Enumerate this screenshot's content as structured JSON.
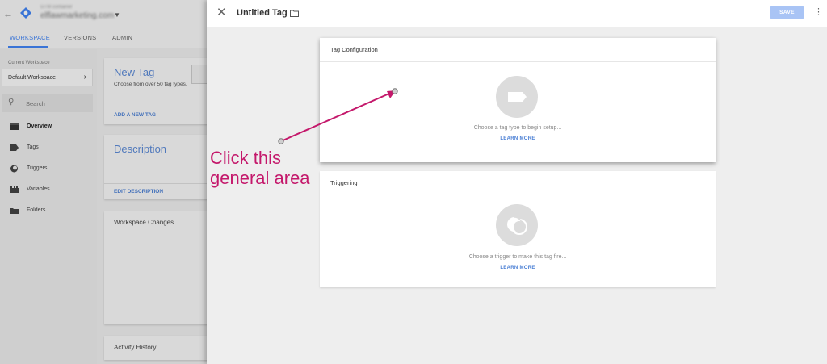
{
  "header": {
    "account_small": "GTM container",
    "account_domain": "elflawmarketing.com"
  },
  "nav_tabs": [
    "WORKSPACE",
    "VERSIONS",
    "ADMIN"
  ],
  "sidebar": {
    "current_workspace_label": "Current Workspace",
    "current_workspace_value": "Default Workspace",
    "search_placeholder": "Search",
    "items": [
      {
        "label": "Overview",
        "icon": "overview-icon"
      },
      {
        "label": "Tags",
        "icon": "tag-icon"
      },
      {
        "label": "Triggers",
        "icon": "trigger-icon"
      },
      {
        "label": "Variables",
        "icon": "variables-icon"
      },
      {
        "label": "Folders",
        "icon": "folder-icon"
      }
    ]
  },
  "cards": {
    "new_tag": {
      "title": "New Tag",
      "subtitle": "Choose from over 50 tag types.",
      "link": "ADD A NEW TAG"
    },
    "description": {
      "title": "Description",
      "link": "EDIT DESCRIPTION"
    },
    "workspace_changes": {
      "title": "Workspace Changes"
    },
    "activity_history": {
      "title": "Activity History"
    }
  },
  "panel": {
    "title": "Untitled Tag",
    "save_label": "SAVE",
    "tag_configuration": {
      "title": "Tag Configuration",
      "hint": "Choose a tag type to begin setup...",
      "link": "LEARN MORE"
    },
    "triggering": {
      "title": "Triggering",
      "hint": "Choose a trigger to make this tag fire...",
      "link": "LEARN MORE"
    }
  },
  "annotation": {
    "line1": "Click this",
    "line2": "general area"
  },
  "colors": {
    "accent": "#4285f4",
    "annotation": "#c4186b",
    "save_disabled": "#a9c4f5"
  }
}
